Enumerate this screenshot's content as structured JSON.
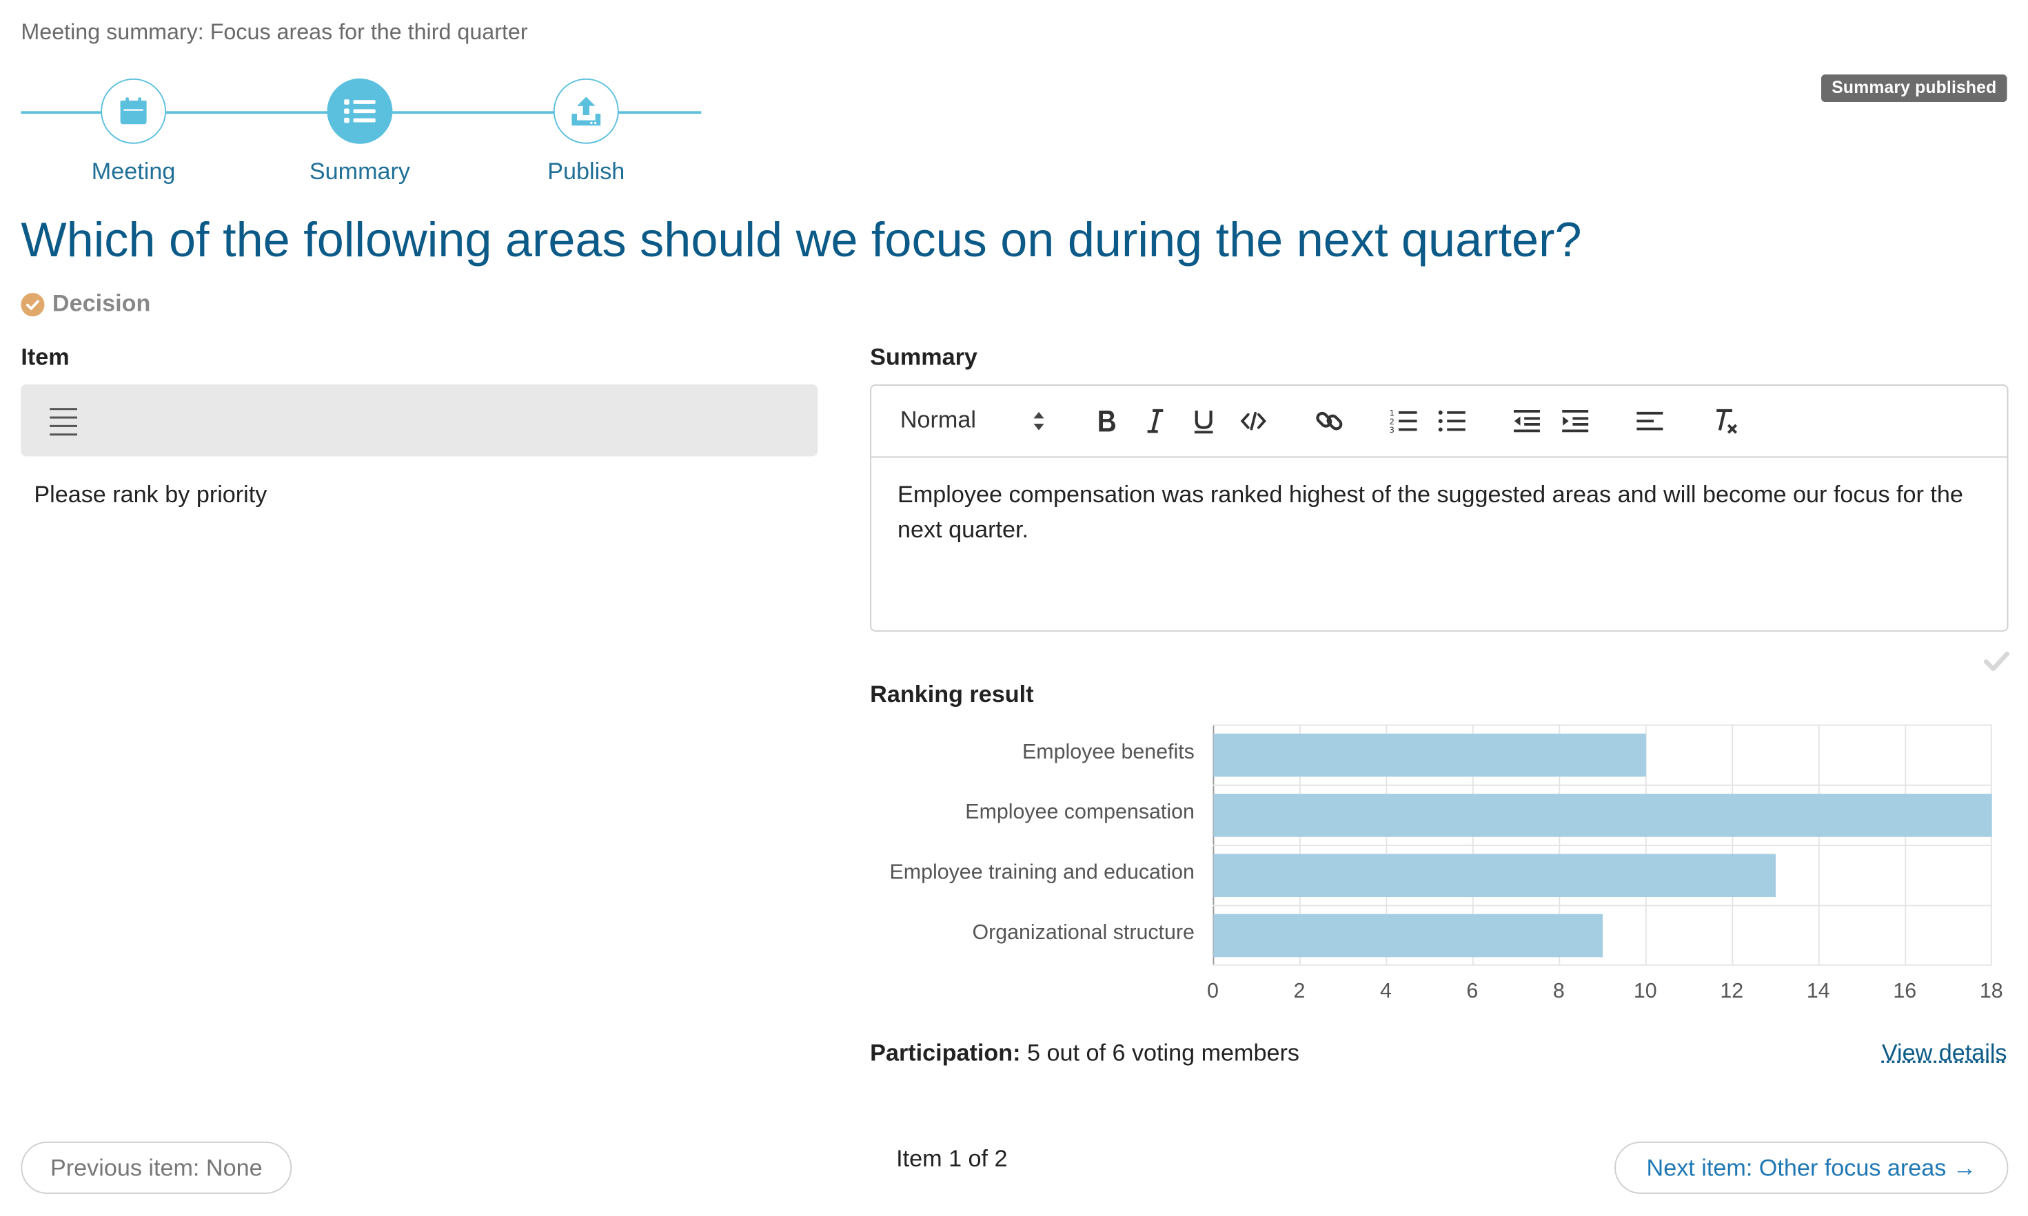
{
  "breadcrumb": "Meeting summary: Focus areas for the third quarter",
  "status_badge": "Summary published",
  "steps": [
    {
      "label": "Meeting",
      "icon": "calendar-icon",
      "active": false
    },
    {
      "label": "Summary",
      "icon": "list-icon",
      "active": true
    },
    {
      "label": "Publish",
      "icon": "upload-icon",
      "active": false
    }
  ],
  "question": "Which of the following areas should we focus on during the next quarter?",
  "decision_label": "Decision",
  "item": {
    "heading": "Item",
    "description": "Please rank by priority"
  },
  "summary": {
    "heading": "Summary",
    "format_select": "Normal",
    "content": "Employee compensation was ranked highest of the suggested areas and will become our focus for the next quarter."
  },
  "ranking": {
    "heading": "Ranking result"
  },
  "chart_data": {
    "type": "bar",
    "orientation": "horizontal",
    "categories": [
      "Employee benefits",
      "Employee compensation",
      "Employee training and education",
      "Organizational structure"
    ],
    "values": [
      10,
      18,
      13,
      9
    ],
    "xlim": [
      0,
      18
    ],
    "xticks": [
      0,
      2,
      4,
      6,
      8,
      10,
      12,
      14,
      16,
      18
    ],
    "grid": true,
    "bar_color": "#a6cee3"
  },
  "participation": {
    "label": "Participation:",
    "value": "5 out of 6 voting members",
    "link": "View details"
  },
  "nav": {
    "previous": "Previous item: None",
    "pager": "Item 1 of 2",
    "next": "Next item: Other focus areas →"
  },
  "colors": {
    "accent": "#5bc0de",
    "title": "#0b5a87",
    "decision_icon": "#e0a86a"
  }
}
